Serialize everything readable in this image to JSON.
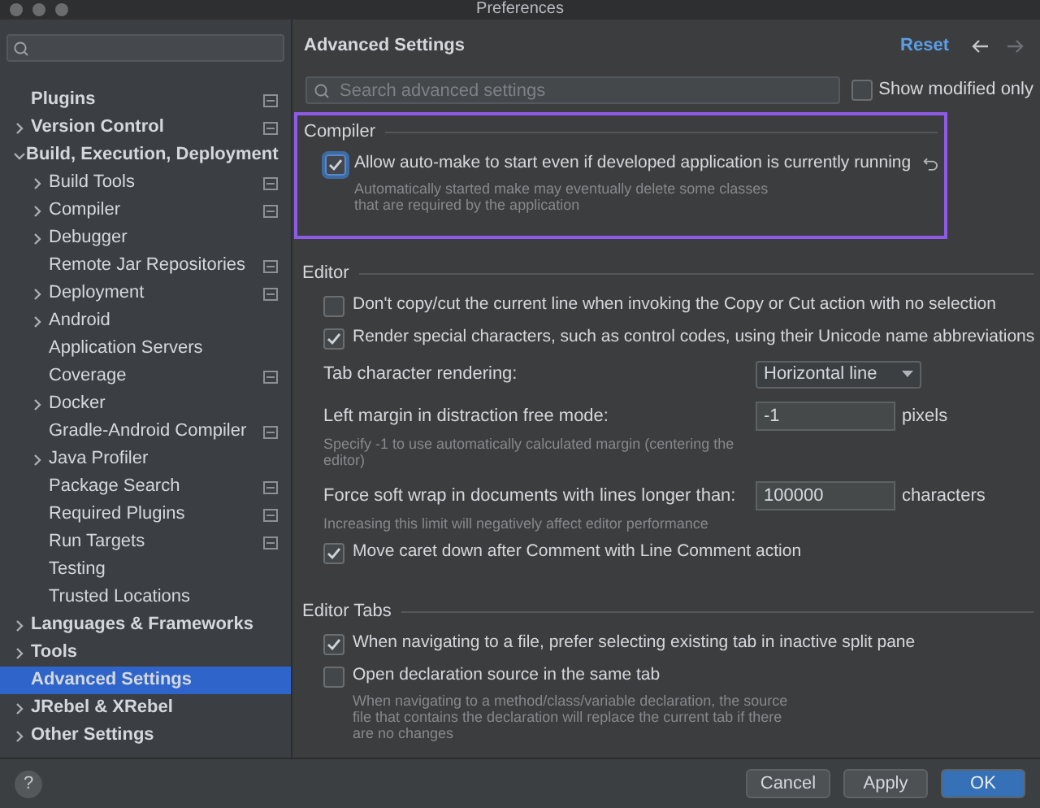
{
  "window": {
    "title": "Preferences"
  },
  "sidebar": {
    "items": [
      {
        "label": "Plugins",
        "expandable": false,
        "expanded": false,
        "selected": false,
        "badge": true
      },
      {
        "label": "Version Control",
        "expandable": true,
        "expanded": false,
        "selected": false,
        "badge": true
      },
      {
        "label": "Build, Execution, Deployment",
        "expandable": true,
        "expanded": true,
        "selected": false,
        "badge": false,
        "children": [
          {
            "label": "Build Tools",
            "expandable": true,
            "expanded": false,
            "selected": false,
            "badge": true
          },
          {
            "label": "Compiler",
            "expandable": true,
            "expanded": false,
            "selected": false,
            "badge": true
          },
          {
            "label": "Debugger",
            "expandable": true,
            "expanded": false,
            "selected": false,
            "badge": false
          },
          {
            "label": "Remote Jar Repositories",
            "expandable": false,
            "expanded": false,
            "selected": false,
            "badge": true
          },
          {
            "label": "Deployment",
            "expandable": true,
            "expanded": false,
            "selected": false,
            "badge": true
          },
          {
            "label": "Android",
            "expandable": true,
            "expanded": false,
            "selected": false,
            "badge": false
          },
          {
            "label": "Application Servers",
            "expandable": false,
            "expanded": false,
            "selected": false,
            "badge": false
          },
          {
            "label": "Coverage",
            "expandable": false,
            "expanded": false,
            "selected": false,
            "badge": true
          },
          {
            "label": "Docker",
            "expandable": true,
            "expanded": false,
            "selected": false,
            "badge": false
          },
          {
            "label": "Gradle-Android Compiler",
            "expandable": false,
            "expanded": false,
            "selected": false,
            "badge": true
          },
          {
            "label": "Java Profiler",
            "expandable": true,
            "expanded": false,
            "selected": false,
            "badge": false
          },
          {
            "label": "Package Search",
            "expandable": false,
            "expanded": false,
            "selected": false,
            "badge": true
          },
          {
            "label": "Required Plugins",
            "expandable": false,
            "expanded": false,
            "selected": false,
            "badge": true
          },
          {
            "label": "Run Targets",
            "expandable": false,
            "expanded": false,
            "selected": false,
            "badge": true
          },
          {
            "label": "Testing",
            "expandable": false,
            "expanded": false,
            "selected": false,
            "badge": false
          },
          {
            "label": "Trusted Locations",
            "expandable": false,
            "expanded": false,
            "selected": false,
            "badge": false
          }
        ]
      },
      {
        "label": "Languages & Frameworks",
        "expandable": true,
        "expanded": false,
        "selected": false,
        "badge": false
      },
      {
        "label": "Tools",
        "expandable": true,
        "expanded": false,
        "selected": false,
        "badge": false
      },
      {
        "label": "Advanced Settings",
        "expandable": false,
        "expanded": false,
        "selected": true,
        "badge": false
      },
      {
        "label": "JRebel & XRebel",
        "expandable": true,
        "expanded": false,
        "selected": false,
        "badge": false
      },
      {
        "label": "Other Settings",
        "expandable": true,
        "expanded": false,
        "selected": false,
        "badge": false
      }
    ]
  },
  "main": {
    "title": "Advanced Settings",
    "reset": "Reset",
    "search": {
      "placeholder": "Search advanced settings"
    },
    "show_modified": {
      "label": "Show modified only",
      "checked": false
    },
    "sections": [
      {
        "title": "Compiler",
        "highlighted": true,
        "settings": [
          {
            "kind": "checkbox",
            "label": "Allow auto-make to start even if developed application is currently running",
            "checked": true,
            "focused": true,
            "modified": true,
            "hint": "Automatically started make may eventually delete some classes that are required by the application"
          }
        ]
      },
      {
        "title": "Editor",
        "highlighted": false,
        "settings": [
          {
            "kind": "checkbox",
            "label": "Don't copy/cut the current line when invoking the Copy or Cut action with no selection",
            "checked": false,
            "focused": false,
            "modified": false
          },
          {
            "kind": "checkbox",
            "label": "Render special characters, such as control codes, using their Unicode name abbreviations",
            "checked": true,
            "focused": false,
            "modified": false
          },
          {
            "kind": "select",
            "label": "Tab character rendering:",
            "value": "Horizontal line"
          },
          {
            "kind": "input",
            "label": "Left margin in distraction free mode:",
            "value": "-1",
            "unit": "pixels",
            "hint": "Specify -1 to use automatically calculated margin (centering the editor)"
          },
          {
            "kind": "input",
            "label": "Force soft wrap in documents with lines longer than:",
            "value": "100000",
            "unit": "characters",
            "hint": "Increasing this limit will negatively affect editor performance"
          },
          {
            "kind": "checkbox",
            "label": "Move caret down after Comment with Line Comment action",
            "checked": true,
            "focused": false,
            "modified": false
          }
        ]
      },
      {
        "title": "Editor Tabs",
        "highlighted": false,
        "settings": [
          {
            "kind": "checkbox",
            "label": "When navigating to a file, prefer selecting existing tab in inactive split pane",
            "checked": true,
            "focused": false,
            "modified": false
          },
          {
            "kind": "checkbox",
            "label": "Open declaration source in the same tab",
            "checked": false,
            "focused": false,
            "modified": false,
            "hint": "When navigating to a method/class/variable declaration, the source file that contains the declaration will replace the current tab if there are no changes"
          }
        ]
      }
    ]
  },
  "footer": {
    "help": "?",
    "buttons": [
      {
        "label": "Cancel",
        "kind": "secondary"
      },
      {
        "label": "Apply",
        "kind": "secondary"
      },
      {
        "label": "OK",
        "kind": "primary"
      }
    ]
  }
}
